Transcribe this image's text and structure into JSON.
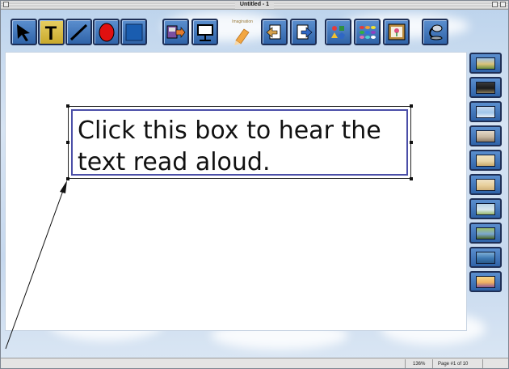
{
  "window": {
    "title": "Untitled - 1"
  },
  "toolbar": {
    "tools": [
      {
        "name": "select-tool",
        "icon": "arrow-pointer-icon"
      },
      {
        "name": "text-tool",
        "icon": "letter-t-icon",
        "label": "T"
      },
      {
        "name": "line-tool",
        "icon": "diagonal-line-icon"
      },
      {
        "name": "oval-tool",
        "icon": "red-oval-icon"
      },
      {
        "name": "rectangle-tool",
        "icon": "blue-rectangle-icon"
      },
      {
        "name": "import-tool",
        "icon": "floppy-arrow-icon"
      },
      {
        "name": "presentation-tool",
        "icon": "easel-icon"
      },
      {
        "name": "previous-page-button",
        "icon": "page-back-arrow-icon"
      },
      {
        "name": "next-page-button",
        "icon": "page-forward-arrow-icon"
      },
      {
        "name": "shapes-palette-button",
        "icon": "shapes-icon"
      },
      {
        "name": "color-palette-button",
        "icon": "color-swatches-icon"
      },
      {
        "name": "picture-button",
        "icon": "framed-flower-icon"
      },
      {
        "name": "speaker-button",
        "icon": "speaker-icon"
      }
    ],
    "logo_text": "Imagination"
  },
  "canvas": {
    "textbox_text": "Click this box to hear the text read aloud."
  },
  "sidepanel": {
    "thumbnails": [
      {
        "name": "thumb-park",
        "colors": [
          "#d9c27a",
          "#6d8f3f",
          "#9fc3e6"
        ]
      },
      {
        "name": "thumb-night",
        "colors": [
          "#1b1b1b",
          "#8a7a5a",
          "#3a3a3a"
        ]
      },
      {
        "name": "thumb-sky",
        "colors": [
          "#9fc6ea",
          "#e8eef6",
          "#c8d9ef"
        ]
      },
      {
        "name": "thumb-building",
        "colors": [
          "#c7b8a2",
          "#8d7b66",
          "#e3d8c8"
        ]
      },
      {
        "name": "thumb-room",
        "colors": [
          "#e8d6a8",
          "#c9a86a",
          "#f1e3c0"
        ]
      },
      {
        "name": "thumb-interior",
        "colors": [
          "#e7cf9b",
          "#d1b27a",
          "#f0e2c4"
        ]
      },
      {
        "name": "thumb-garden",
        "colors": [
          "#d8e8f0",
          "#98b86a",
          "#b7d3e3"
        ]
      },
      {
        "name": "thumb-tree",
        "colors": [
          "#7aa6cf",
          "#4d6b2c",
          "#9bbf6a"
        ]
      },
      {
        "name": "thumb-ocean",
        "colors": [
          "#3d79b2",
          "#2a5a8a",
          "#7fb0d8"
        ]
      },
      {
        "name": "thumb-sunset",
        "colors": [
          "#f0b060",
          "#8a5a9a",
          "#f7d98a"
        ]
      }
    ]
  },
  "statusbar": {
    "zoom": "136%",
    "page": "Page #1 of 10"
  }
}
